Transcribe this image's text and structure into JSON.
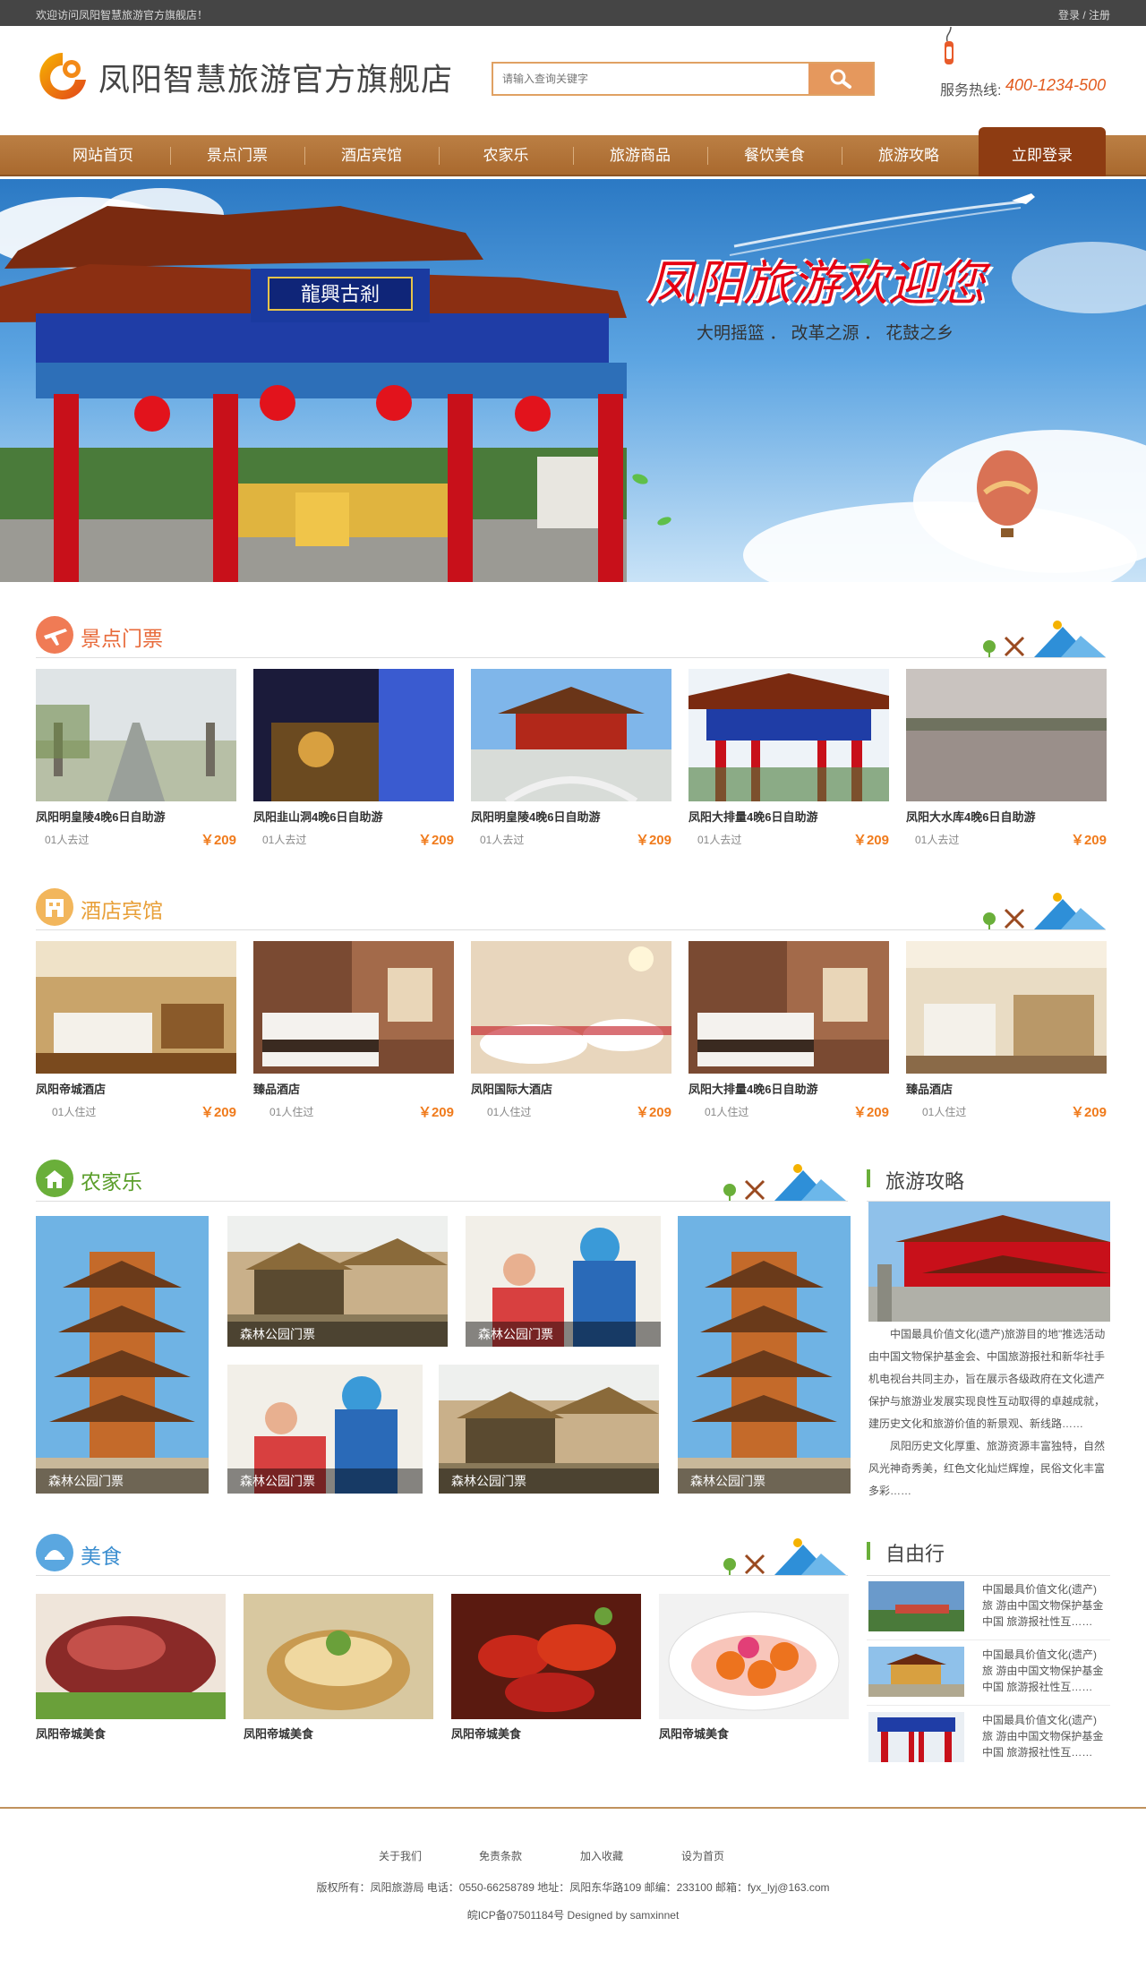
{
  "topbar": {
    "welcome": "欢迎访问凤阳智慧旅游官方旗舰店！",
    "login": "登录 / 注册"
  },
  "header": {
    "site_name": "凤阳智慧旅游官方旗舰店",
    "search_placeholder": "请输入查询关键字",
    "hotline_label": "服务热线:",
    "hotline_number": "400-1234-500"
  },
  "nav": {
    "items": [
      "网站首页",
      "景点门票",
      "酒店宾馆",
      "农家乐",
      "旅游商品",
      "餐饮美食",
      "旅游攻略"
    ],
    "login": "立即登录"
  },
  "banner": {
    "title": "凤阳旅游欢迎您",
    "slogan": "大明摇篮 ． 改革之源 ． 花鼓之乡",
    "gate_plaque": "龍興古剎"
  },
  "sections": {
    "spots": {
      "title": "景点门票",
      "items": [
        {
          "name": "凤阳明皇陵4晚6日自助游",
          "meta": "01人去过",
          "price": "￥209"
        },
        {
          "name": "凤阳韭山洞4晚6日自助游",
          "meta": "01人去过",
          "price": "￥209"
        },
        {
          "name": "凤阳明皇陵4晚6日自助游",
          "meta": "01人去过",
          "price": "￥209"
        },
        {
          "name": "凤阳大排量4晚6日自助游",
          "meta": "01人去过",
          "price": "￥209"
        },
        {
          "name": "凤阳大水库4晚6日自助游",
          "meta": "01人去过",
          "price": "￥209"
        }
      ]
    },
    "hotels": {
      "title": "酒店宾馆",
      "items": [
        {
          "name": "凤阳帝城酒店",
          "meta": "01人住过",
          "price": "￥209"
        },
        {
          "name": "臻品酒店",
          "meta": "01人住过",
          "price": "￥209"
        },
        {
          "name": "凤阳国际大酒店",
          "meta": "01人住过",
          "price": "￥209"
        },
        {
          "name": "凤阳大排量4晚6日自助游",
          "meta": "01人住过",
          "price": "￥209"
        },
        {
          "name": "臻品酒店",
          "meta": "01人住过",
          "price": "￥209"
        }
      ]
    },
    "farm": {
      "title": "农家乐",
      "captions": [
        "森林公园门票",
        "森林公园门票",
        "森林公园门票",
        "森林公园门票",
        "森林公园门票",
        "森林公园门票"
      ]
    },
    "food": {
      "title": "美食",
      "items": [
        "凤阳帝城美食",
        "凤阳帝城美食",
        "凤阳帝城美食",
        "凤阳帝城美食"
      ]
    }
  },
  "sidebar": {
    "guide": {
      "title": "旅游攻略",
      "paragraph1": "中国最具价值文化(遗产)旅游目的地\"推选活动由中国文物保护基金会、中国旅游报社和新华社手机电视台共同主办，旨在展示各级政府在文化遗产保护与旅游业发展实现良性互动取得的卓越成就，建历史文化和旅游价值的新景观、新线路……",
      "paragraph2": "凤阳历史文化厚重、旅游资源丰富独特，自然风光神奇秀美，红色文化灿烂辉煌，民俗文化丰富多彩……"
    },
    "free": {
      "title": "自由行",
      "items": [
        "中国最具价值文化(遗产) 旅 游由中国文物保护基金 中国 旅游报社性互……",
        "中国最具价值文化(遗产) 旅 游由中国文物保护基金 中国 旅游报社性互……",
        "中国最具价值文化(遗产) 旅 游由中国文物保护基金 中国 旅游报社性互……"
      ]
    }
  },
  "footer": {
    "links": [
      "关于我们",
      "免责条款",
      "加入收藏",
      "设为首页"
    ],
    "copyright": "版权所有：凤阳旅游局 电话：0550-66258789 地址：凤阳东华路109 邮编：233100 邮箱：fyx_lyj@163.com",
    "icp": "皖ICP备07501184号 Designed by samxinnet"
  },
  "colors": {
    "accent_orange": "#f07b1c",
    "nav_brown": "#b27537",
    "login_dark": "#8e3c12",
    "green": "#6aaf3a"
  }
}
